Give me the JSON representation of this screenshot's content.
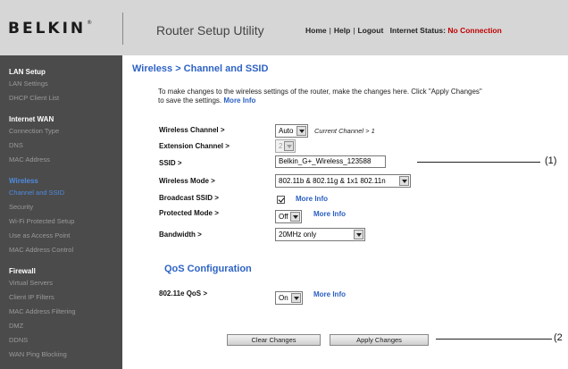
{
  "header": {
    "logo": "BELKIN",
    "logo_mark": "®",
    "app_title": "Router Setup Utility",
    "nav": {
      "home": "Home",
      "help": "Help",
      "logout": "Logout",
      "separator": "|"
    },
    "status_label": "Internet Status:",
    "status_value": "No Connection",
    "status_color": "#c00000"
  },
  "sidebar": {
    "sections": [
      {
        "title": "LAN Setup",
        "items": [
          "LAN Settings",
          "DHCP Client List"
        ]
      },
      {
        "title": "Internet WAN",
        "items": [
          "Connection Type",
          "DNS",
          "MAC Address"
        ]
      },
      {
        "title": "Wireless",
        "items": [
          "Channel and SSID",
          "Security",
          "Wi-Fi Protected Setup",
          "Use as Access Point",
          "MAC Address Control"
        ]
      },
      {
        "title": "Firewall",
        "items": [
          "Virtual Servers",
          "Client IP Filters",
          "MAC Address Filtering",
          "DMZ",
          "DDNS",
          "WAN Ping Blocking"
        ]
      }
    ],
    "active_color": "#4f8be0"
  },
  "main": {
    "title": "Wireless > Channel and SSID",
    "intro": "To make changes to the wireless settings of the router, make the changes here. Click \"Apply Changes\" to save the settings.",
    "more_info": "More Info",
    "fields": {
      "wireless_channel": {
        "label": "Wireless Channel >",
        "value": "Auto",
        "note": "Current Channel > 1"
      },
      "extension_channel": {
        "label": "Extension Channel >",
        "value": "2"
      },
      "ssid": {
        "label": "SSID >",
        "value": "Belkin_G+_Wireless_123588"
      },
      "wireless_mode": {
        "label": "Wireless Mode >",
        "value": "802.11b & 802.11g & 1x1 802.11n"
      },
      "broadcast_ssid": {
        "label": "Broadcast SSID >",
        "checked": true,
        "more_info": "More Info"
      },
      "protected_mode": {
        "label": "Protected Mode >",
        "value": "Off",
        "more_info": "More Info"
      },
      "bandwidth": {
        "label": "Bandwidth >",
        "value": "20MHz only"
      }
    },
    "qos": {
      "title": "QoS Configuration",
      "wmm": {
        "label": "802.11e QoS >",
        "value": "On",
        "more_info": "More Info"
      }
    },
    "buttons": {
      "clear": "Clear Changes",
      "apply": "Apply Changes"
    }
  },
  "callouts": {
    "ssid": "(1)",
    "buttons": "(2"
  },
  "colors": {
    "title_blue": "#2e63c4",
    "link_blue": "#2a5fc2",
    "sidebar_bg": "#4b4b4b",
    "header_bg": "#d6d6d6"
  }
}
